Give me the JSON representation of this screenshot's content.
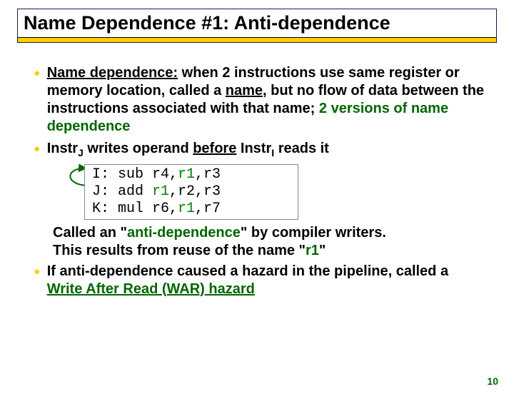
{
  "title": "Name Dependence #1: Anti-dependence",
  "bullets": {
    "b1_pre": "Name dependence:",
    "b1_mid": " when 2 instructions use same register or memory location, called a ",
    "b1_name": "name",
    "b1_mid2": ", but no flow of data between the instructions associated with that name; ",
    "b1_green": "2 versions of name dependence",
    "b2_pre": "Instr",
    "b2_subJ": "J",
    "b2_mid": " writes operand ",
    "b2_before": "before",
    "b2_mid2": " Instr",
    "b2_subI": "I",
    "b2_end": " reads it",
    "after1_a": "Called an \"",
    "after1_green": "anti-dependence",
    "after1_b": "\" by compiler writers.",
    "after2_a": "This results from reuse of the name \"",
    "after2_r1": "r1",
    "after2_b": "\"",
    "b3_a": "If anti-dependence caused a hazard in the pipeline, called a ",
    "b3_green": "Write After Read (WAR) hazard"
  },
  "code": {
    "l1a": "I: sub r4,",
    "l1b": "r1",
    "l1c": ",r3",
    "l2a": "J: add ",
    "l2b": "r1",
    "l2c": ",r2,r3",
    "l3a": "K: mul r6,",
    "l3b": "r1",
    "l3c": ",r7"
  },
  "pagenum": "10"
}
